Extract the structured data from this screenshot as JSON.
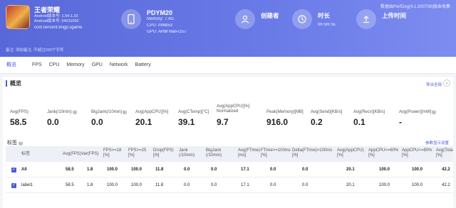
{
  "header": {
    "top_right": "数据由PerfDog(4.1.200708)版本收集",
    "app": {
      "name": "王者荣耀",
      "android_ver": "Android版本号: 1.54.1.10",
      "android_code": "Android版本号: 54011002",
      "package": "com.tencent.tmgp.sgame"
    },
    "remark": "备注: 添加备注, 不超过200个字符",
    "device": {
      "name": "PDYM20",
      "memory": "Memory: 7.4G",
      "cpu": "CPU: mt6853",
      "gpu": "GPU: ARM Mali-G57"
    },
    "creator": {
      "title": "创建者",
      "value": ""
    },
    "duration": {
      "title": "时长",
      "value": "0h 5m 5s"
    },
    "upload": {
      "title": "上传时间",
      "value": ""
    }
  },
  "tabs": [
    "概览",
    "FPS",
    "CPU",
    "Memory",
    "GPU",
    "Network",
    "Battery"
  ],
  "overview": {
    "title": "概览",
    "export": "导出全部",
    "metrics": [
      {
        "label": "Avg(FPS)",
        "value": "58.5"
      },
      {
        "label": "Jank(/10min)",
        "value": "0.0"
      },
      {
        "label": "BigJank(/10min)",
        "value": "0.0"
      },
      {
        "label": "Avg(AppCPU)[%]",
        "value": "20.1"
      },
      {
        "label": "Avg(CTemp)[°C]",
        "value": "39.1"
      },
      {
        "label": "Avg(AppCPU)[%] Normalized",
        "value": "9.7"
      },
      {
        "label": "Peak(Memory)[MB]",
        "value": "916.0"
      },
      {
        "label": "Avg(Send)[KB/s]",
        "value": "0.2"
      },
      {
        "label": "Avg(Recv)[KB/s]",
        "value": "0.1"
      },
      {
        "label": "Avg(Power)[mW]",
        "value": "-"
      }
    ]
  },
  "tags": {
    "title": "标签",
    "settings": "参数显示设置",
    "columns": [
      "标签",
      "Avg(FPS)",
      "Var(FPS)",
      "FPS>=18 [%]",
      "FPS>=25 [%]",
      "Drop(FPS) [/h]",
      "Jank (/10min)",
      "BigJank (/10min)",
      "Avg(FTime) [ms]",
      "FTime>=100ms [%]",
      "Delta(FTime)>100ms [/h]",
      "Avg(AppCPU) [%]",
      "AppCPU<=60% [%]",
      "AppCPU<=80% [%]",
      "Avg(Tota [%]"
    ],
    "rows": [
      {
        "label": "All",
        "cells": [
          "58.5",
          "1.8",
          "100.0",
          "100.0",
          "11.8",
          "0.0",
          "0.0",
          "17.1",
          "0.0",
          "0.0",
          "20.1",
          "100.0",
          "100.0",
          "42.2"
        ]
      },
      {
        "label": "label1",
        "cells": [
          "58.5",
          "1.8",
          "100.0",
          "100.0",
          "11.8",
          "0.0",
          "0.0",
          "17.1",
          "0.0",
          "0.0",
          "20.1",
          "100.0",
          "100.0",
          "42.2"
        ]
      }
    ]
  },
  "icons": {
    "device": "phone-icon",
    "creator": "user-icon",
    "duration": "clock-icon",
    "upload": "upload-icon"
  }
}
